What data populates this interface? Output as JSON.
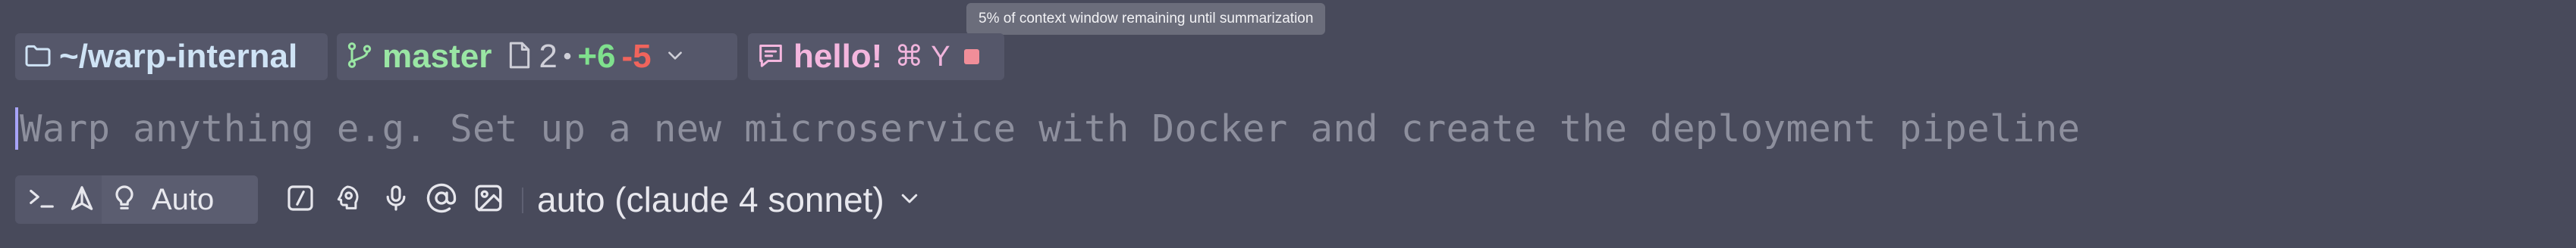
{
  "tooltip": {
    "text": "5% of context window remaining until summarization"
  },
  "context_chips": {
    "cwd": {
      "path": "~/warp-internal",
      "icon": "folder-icon"
    },
    "git": {
      "branch": "master",
      "changed_files": "2",
      "separator": "•",
      "additions": "+6",
      "deletions": "-5",
      "branch_icon": "git-branch-icon",
      "files_icon": "file-icon",
      "dropdown_icon": "chevron-down-icon"
    },
    "conversation": {
      "title": "hello!",
      "shortcut": "⌘ Y",
      "icon": "chat-bubble-icon",
      "stop_icon": "stop-square-icon"
    }
  },
  "input": {
    "placeholder": "Warp anything e.g. Set up a new microservice with Docker and create the deployment pipeline"
  },
  "toolbar": {
    "modes": {
      "terminal_icon": "terminal-prompt-icon",
      "agent_icon": "agent-icon",
      "auto_icon": "lightbulb-icon",
      "auto_label": "Auto"
    },
    "tools": [
      {
        "name": "slash-commands",
        "icon": "slash-command-icon"
      },
      {
        "name": "profile",
        "icon": "profile-head-icon"
      },
      {
        "name": "voice-input",
        "icon": "microphone-icon"
      },
      {
        "name": "mention",
        "icon": "at-sign-icon"
      },
      {
        "name": "attach-image",
        "icon": "image-icon"
      }
    ],
    "model": {
      "label": "auto (claude 4 sonnet)",
      "dropdown_icon": "chevron-down-icon"
    }
  },
  "colors": {
    "background": "#484a5b",
    "chip_background": "#55576a",
    "branch_green": "#9ae6a4",
    "additions_green": "#7fe08d",
    "deletions_red": "#f0645c",
    "conversation_pink": "#f4b6de",
    "caret_purple": "#a8a4f8"
  }
}
